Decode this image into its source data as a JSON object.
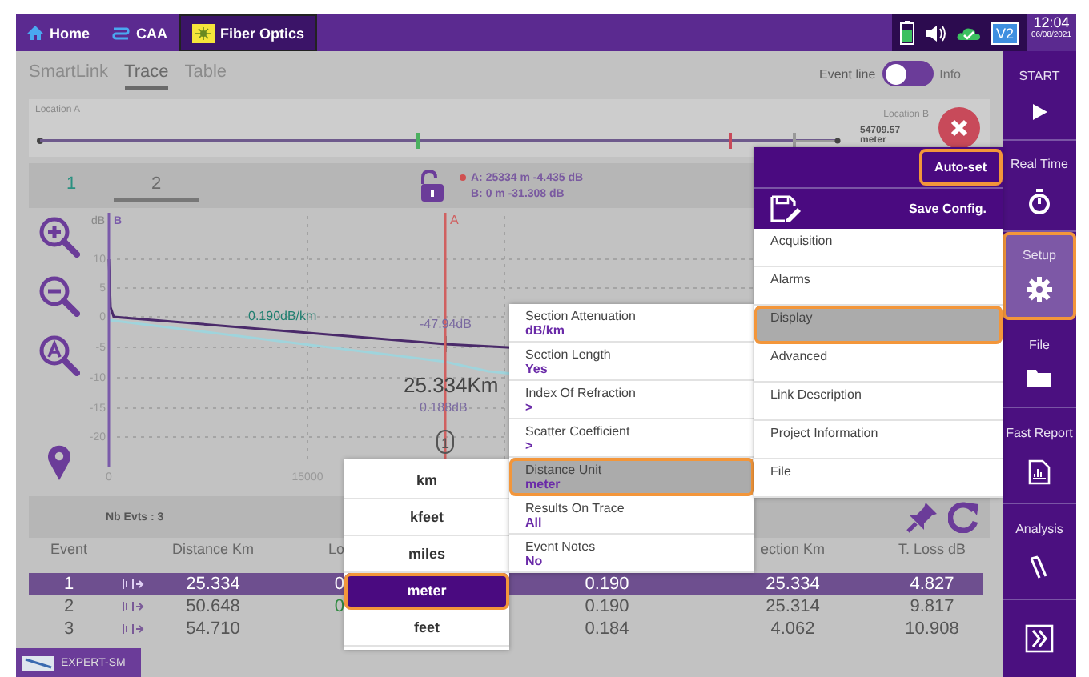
{
  "top_bar": {
    "tabs": [
      {
        "label": "Home",
        "selected": false
      },
      {
        "label": "CAA",
        "selected": false
      },
      {
        "label": "Fiber Optics",
        "selected": true
      }
    ],
    "status": {
      "badge": "V2",
      "time": "12:04",
      "date": "06/08/2021"
    }
  },
  "view_tabs": [
    {
      "label": "SmartLink",
      "selected": false
    },
    {
      "label": "Trace",
      "selected": true
    },
    {
      "label": "Table",
      "selected": false
    }
  ],
  "event_toggle": {
    "left_label": "Event line",
    "right_label": "Info",
    "on": false
  },
  "location_bar": {
    "start_label": "Location A",
    "end_label": "Location B",
    "end_value": "54709.57 meter"
  },
  "trace_tabs": [
    {
      "label": "1",
      "color": "#2a9080",
      "selected": false
    },
    {
      "label": "2",
      "color": "#6b6b6b",
      "selected": true
    }
  ],
  "cursor_readout": {
    "a": "A: 25334 m -4.435 dB",
    "b": "B: 0 m -31.308 dB"
  },
  "plot": {
    "y_unit": "dB",
    "y_ticks": [
      "10",
      "5",
      "0",
      "-5",
      "-10",
      "-15",
      "-20"
    ],
    "x_ticks": [
      "0",
      "15000"
    ],
    "cursor_a": "A",
    "cursor_b": "B",
    "event_marker": "1",
    "slope_label": "0.190dB/km",
    "level_label": "-47.94dB",
    "distance_label": "25.334Km",
    "loss_label": "0.188dB"
  },
  "events": {
    "count": "Nb Evts : 3",
    "columns": [
      "Event",
      "Distance Km",
      "Lo",
      "",
      "ection Km",
      "T. Loss dB"
    ],
    "rows": [
      {
        "selected": true,
        "cells": [
          "1",
          "25.334",
          "0",
          "0.190",
          "25.334",
          "4.827"
        ]
      },
      {
        "selected": false,
        "cells": [
          "2",
          "50.648",
          "0",
          "0.190",
          "25.314",
          "9.817"
        ]
      },
      {
        "selected": false,
        "cells": [
          "3",
          "54.710",
          null,
          "0.184",
          "4.062",
          "10.908"
        ]
      }
    ]
  },
  "setup_menu": {
    "auto_set": {
      "label": "Auto-set",
      "highlighted": true
    },
    "save": "Save Config.",
    "items": [
      {
        "label": "Acquisition",
        "selected": false,
        "highlighted": false
      },
      {
        "label": "Alarms",
        "selected": false,
        "highlighted": false
      },
      {
        "label": "Display",
        "selected": true,
        "highlighted": true
      },
      {
        "label": "Advanced",
        "selected": false,
        "highlighted": false
      },
      {
        "label": "Link Description",
        "selected": false,
        "highlighted": false
      },
      {
        "label": "Project Information",
        "selected": false,
        "highlighted": false
      },
      {
        "label": "File",
        "selected": false,
        "highlighted": false
      }
    ]
  },
  "display_menu": {
    "items": [
      {
        "label": "Section Attenuation",
        "value": "dB/km",
        "selected": false,
        "highlighted": false
      },
      {
        "label": "Section Length",
        "value": "Yes",
        "selected": false,
        "highlighted": false
      },
      {
        "label": "Index Of Refraction",
        "value": ">",
        "selected": false,
        "highlighted": false
      },
      {
        "label": "Scatter Coefficient",
        "value": ">",
        "selected": false,
        "highlighted": false
      },
      {
        "label": "Distance Unit",
        "value": "meter",
        "selected": true,
        "highlighted": true
      },
      {
        "label": "Results On Trace",
        "value": "All",
        "selected": false,
        "highlighted": false
      },
      {
        "label": "Event Notes",
        "value": "No",
        "selected": false,
        "highlighted": false
      }
    ]
  },
  "unit_menu": {
    "items": [
      {
        "label": "km",
        "selected": false,
        "highlighted": false
      },
      {
        "label": "kfeet",
        "selected": false,
        "highlighted": false
      },
      {
        "label": "miles",
        "selected": false,
        "highlighted": false
      },
      {
        "label": "meter",
        "selected": true,
        "highlighted": true
      },
      {
        "label": "feet",
        "selected": false,
        "highlighted": false
      }
    ]
  },
  "sidebar": {
    "items": [
      {
        "label": "START",
        "selected": false,
        "highlighted": false
      },
      {
        "label": "Real Time",
        "selected": false,
        "highlighted": false
      },
      {
        "label": "Setup",
        "selected": true,
        "highlighted": true
      },
      {
        "label": "File",
        "selected": false,
        "highlighted": false
      },
      {
        "label": "Fast Report",
        "selected": false,
        "highlighted": false
      },
      {
        "label": "Analysis",
        "selected": false,
        "highlighted": false
      }
    ]
  },
  "footer": {
    "tab": "EXPERT-SM"
  }
}
